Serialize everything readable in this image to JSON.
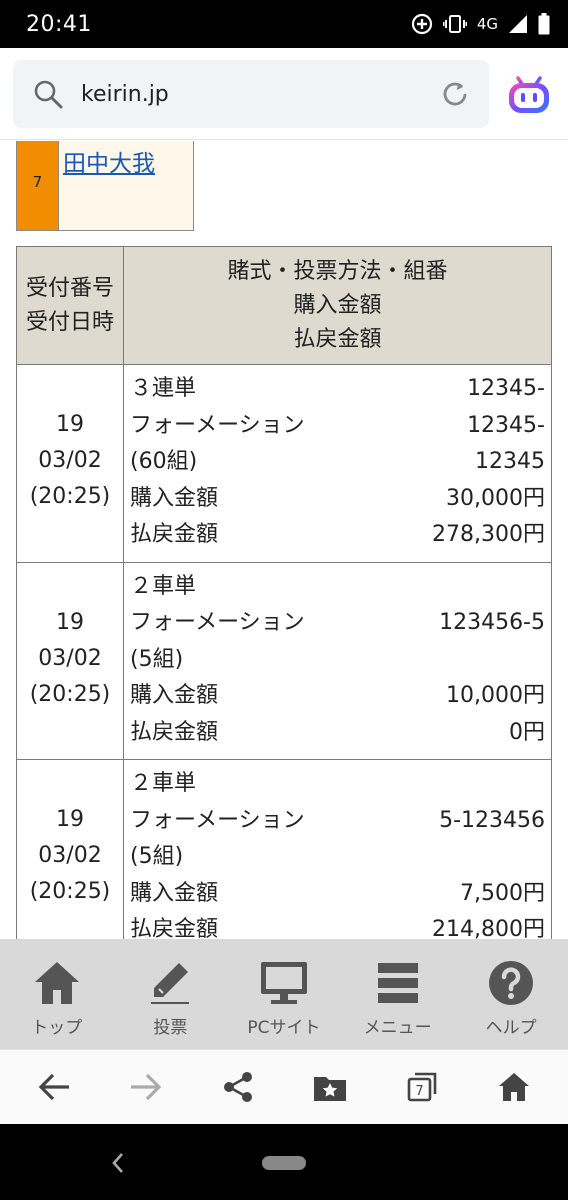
{
  "status_bar": {
    "time": "20:41",
    "network": "4G",
    "icons": [
      "add-circle-icon",
      "vibrate-icon",
      "signal-icon",
      "battery-icon"
    ]
  },
  "browser": {
    "url": "keirin.jp",
    "icons": [
      "search-icon",
      "reload-icon",
      "assistant-icon"
    ]
  },
  "rider": {
    "number": "7",
    "name": "田中大我"
  },
  "bet_table": {
    "header_left_line1": "受付番号",
    "header_left_line2": "受付日時",
    "header_right_line1": "賭式・投票方法・組番",
    "header_right_line2": "購入金額",
    "header_right_line3": "払戻金額",
    "rows": [
      {
        "receipt_no": "19",
        "date": "03/02",
        "time": "(20:25)",
        "bet_type": "３連単",
        "combo_1": "12345-",
        "method": "フォーメーション",
        "combo_2": "12345-",
        "sets": "(60組)",
        "combo_3": "12345",
        "purchase_label": "購入金額",
        "purchase": "30,000円",
        "payout_label": "払戻金額",
        "payout": "278,300円"
      },
      {
        "receipt_no": "19",
        "date": "03/02",
        "time": "(20:25)",
        "bet_type": "２車単",
        "method": "フォーメーション",
        "combo_1": "123456-5",
        "sets": "(5組)",
        "purchase_label": "購入金額",
        "purchase": "10,000円",
        "payout_label": "払戻金額",
        "payout": "0円"
      },
      {
        "receipt_no": "19",
        "date": "03/02",
        "time": "(20:25)",
        "bet_type": "２車単",
        "method": "フォーメーション",
        "combo_1": "5-123456",
        "sets": "(5組)",
        "purchase_label": "購入金額",
        "purchase": "7,500円",
        "payout_label": "払戻金額",
        "payout": "214,800円"
      }
    ]
  },
  "site_nav": {
    "items": [
      {
        "label": "トップ",
        "icon": "home-icon"
      },
      {
        "label": "投票",
        "icon": "pencil-icon"
      },
      {
        "label": "PCサイト",
        "icon": "monitor-icon"
      },
      {
        "label": "メニュー",
        "icon": "menu-icon"
      },
      {
        "label": "ヘルプ",
        "icon": "help-icon"
      }
    ]
  },
  "browser_toolbar": {
    "tab_count": "7",
    "icons": [
      "back-arrow-icon",
      "forward-arrow-icon",
      "share-icon",
      "bookmarks-icon",
      "tabs-icon",
      "home-icon"
    ]
  },
  "colors": {
    "rider_number_bg": "#f28c00",
    "rider_name_bg": "#fff8ea",
    "table_header_bg": "#dedad0",
    "site_nav_bg": "#d9d9d9",
    "link_color": "#1a58b8"
  }
}
